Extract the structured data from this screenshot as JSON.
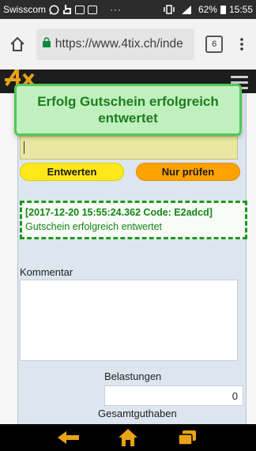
{
  "status_bar": {
    "carrier": "Swisscom",
    "dots": "···",
    "battery_percent": "62%",
    "time": "15:55"
  },
  "browser": {
    "url": "https://www.4tix.ch/inde",
    "tab_count": "6"
  },
  "site": {
    "logo": "4tix"
  },
  "toast": {
    "message": "Erfolg Gutschein erfolgreich entwertet"
  },
  "form": {
    "redeem_button": "Entwerten",
    "check_button": "Nur prüfen",
    "result_title": "[2017-12-20 15:55:24.362 Code: E2adcd]",
    "result_message": "Gutschein erfolgreich entwertet",
    "comment_label": "Kommentar",
    "charges_label": "Belastungen",
    "charges_value": "0",
    "total_balance_label": "Gesamtguthaben"
  },
  "colors": {
    "toast_bg": "#bff0be",
    "toast_border": "#55c755",
    "redeem_button": "#ffe81a",
    "check_button": "#ffa200",
    "success_text": "#158515"
  }
}
